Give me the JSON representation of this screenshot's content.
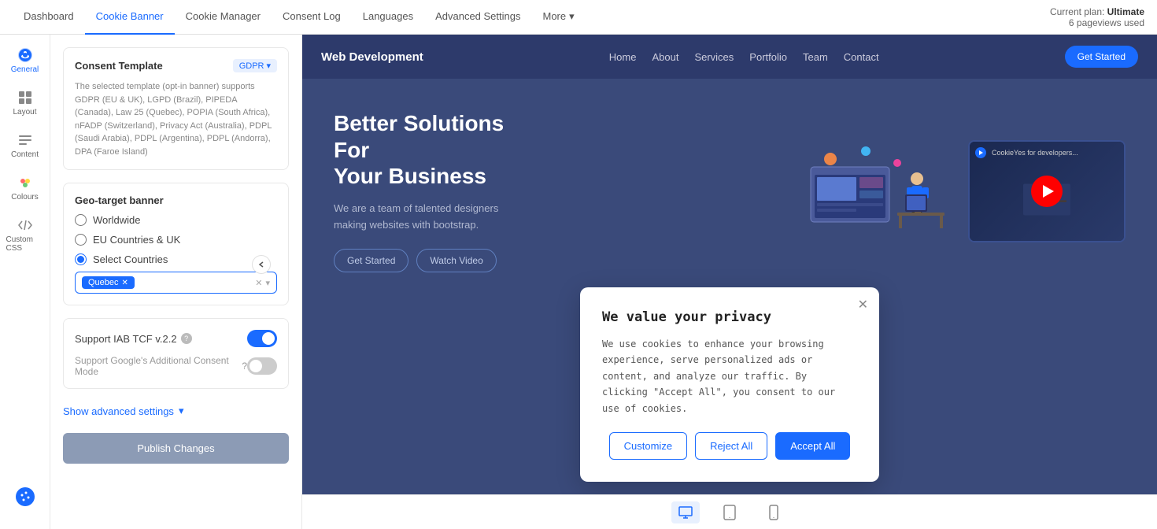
{
  "topNav": {
    "items": [
      {
        "label": "Dashboard",
        "active": false
      },
      {
        "label": "Cookie Banner",
        "active": true
      },
      {
        "label": "Cookie Manager",
        "active": false
      },
      {
        "label": "Consent Log",
        "active": false
      },
      {
        "label": "Languages",
        "active": false
      },
      {
        "label": "Advanced Settings",
        "active": false
      },
      {
        "label": "More",
        "active": false
      }
    ],
    "plan": {
      "prefix": "Current plan: ",
      "name": "Ultimate",
      "usage": "6 pageviews used"
    }
  },
  "sidebar": {
    "items": [
      {
        "label": "General",
        "active": true
      },
      {
        "label": "Layout",
        "active": false
      },
      {
        "label": "Content",
        "active": false
      },
      {
        "label": "Colours",
        "active": false
      },
      {
        "label": "Custom CSS",
        "active": false
      }
    ]
  },
  "leftPanel": {
    "consentTemplate": {
      "title": "Consent Template",
      "badge": "GDPR",
      "description": "The selected template (opt-in banner) supports GDPR (EU & UK), LGPD (Brazil), PIPEDA (Canada), Law 25 (Quebec), POPIA (South Africa), nFADP (Switzerland), Privacy Act (Australia), PDPL (Saudi Arabia), PDPL (Argentina), PDPL (Andorra), DPA (Faroe Island)"
    },
    "geoTarget": {
      "title": "Geo-target banner",
      "options": [
        {
          "label": "Worldwide",
          "value": "worldwide"
        },
        {
          "label": "EU Countries & UK",
          "value": "eu"
        },
        {
          "label": "Select Countries",
          "value": "select",
          "selected": true
        }
      ],
      "selectedTag": "Quebec",
      "placeholder": ""
    },
    "iab": {
      "title": "Support IAB TCF v.2.2",
      "toggled": true,
      "subLabel": "Support Google's Additional Consent Mode",
      "subToggled": false,
      "infoIcon": "?"
    },
    "advancedSettings": {
      "label": "Show advanced settings"
    },
    "publishBtn": "Publish Changes"
  },
  "preview": {
    "navbar": {
      "brand": "Web Development",
      "links": [
        "Home",
        "About",
        "Services",
        "Portfolio",
        "Team",
        "Contact"
      ],
      "cta": "Get Started"
    },
    "hero": {
      "titleLine1": "Better Solutions",
      "titleLine2": "For",
      "titleLine3": "Your Business",
      "description": "We are a team of talented designers making websites with bootstrap.",
      "btn1": "Get Started",
      "btn2": "Watch Video"
    },
    "video": {
      "label": "CookieYes for developers..."
    },
    "cookieBanner": {
      "title": "We value your privacy",
      "description": "We use cookies to enhance your browsing experience, serve personalized ads or content, and analyze our traffic. By clicking \"Accept All\", you consent to our use of cookies.",
      "btn1": "Customize",
      "btn2": "Reject All",
      "btn3": "Accept All"
    }
  }
}
